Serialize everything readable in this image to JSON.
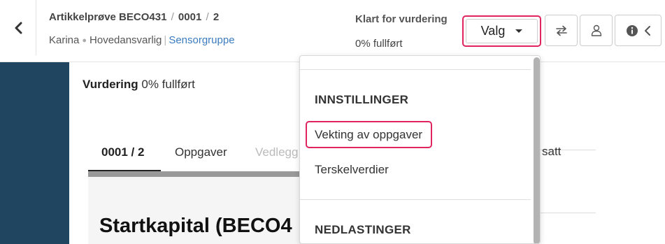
{
  "header": {
    "exam_title": "Artikkelprøve BECO431",
    "separator": "/",
    "candidate": "0001",
    "page_count": "2",
    "user_name": "Karina",
    "role": "Hovedansvarlig",
    "pipe": "|",
    "group_link": "Sensorgruppe",
    "status_title": "Klart for vurdering",
    "status_progress": "0% fullført",
    "valg_label": "Valg"
  },
  "main": {
    "vurdering_label": "Vurdering",
    "vurdering_progress": "0% fullført",
    "tabs": [
      {
        "label": "0001 / 2",
        "state": "active"
      },
      {
        "label": "Oppgaver",
        "state": "normal"
      },
      {
        "label": "Vedlegg",
        "state": "disabled"
      }
    ],
    "tab_tail": "satt",
    "content_title": "Startkapital (BECO4"
  },
  "dropdown": {
    "section_settings": "INNSTILLINGER",
    "item_weighting": "Vekting av oppgaver",
    "item_thresholds": "Terskelverdier",
    "section_downloads": "NEDLASTINGER"
  },
  "icons": {
    "back": "chevron-left-icon",
    "swap": "swap-arrows-icon",
    "user": "user-icon",
    "info": "info-icon",
    "collapse": "chevron-left-icon"
  },
  "colors": {
    "highlight": "#e0245e",
    "sidebar": "#1f4560",
    "link": "#3b7bbf"
  }
}
